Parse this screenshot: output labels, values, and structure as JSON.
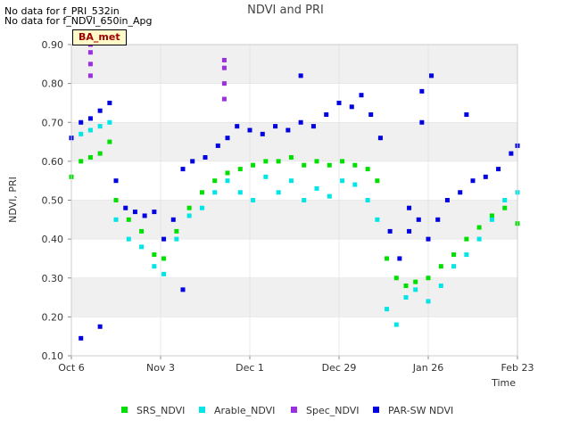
{
  "notes": [
    "No data for f_PRI_532in",
    "No data for f_NDVI_650in_Apg"
  ],
  "badge": "BA_met",
  "chart_data": {
    "type": "scatter",
    "title": "NDVI and PRI",
    "xlabel": "Time",
    "ylabel": "NDVI, PRI",
    "xlim": [
      "2023-10-06",
      "2024-02-23"
    ],
    "ylim": [
      0.1,
      0.9
    ],
    "yticks": [
      "0.10",
      "0.20",
      "0.30",
      "0.40",
      "0.50",
      "0.60",
      "0.70",
      "0.80",
      "0.90"
    ],
    "xticks": [
      {
        "date": "2023-10-06",
        "label": "Oct 6"
      },
      {
        "date": "2023-11-03",
        "label": "Nov 3"
      },
      {
        "date": "2023-12-01",
        "label": "Dec 1"
      },
      {
        "date": "2023-12-29",
        "label": "Dec 29"
      },
      {
        "date": "2024-01-26",
        "label": "Jan 26"
      },
      {
        "date": "2024-02-23",
        "label": "Feb 23"
      }
    ],
    "grid": true,
    "legend_position": "bottom",
    "series": [
      {
        "name": "SRS_NDVI",
        "color": "#00e000",
        "points": [
          [
            "2023-10-06",
            0.56
          ],
          [
            "2023-10-09",
            0.6
          ],
          [
            "2023-10-12",
            0.61
          ],
          [
            "2023-10-15",
            0.62
          ],
          [
            "2023-10-18",
            0.65
          ],
          [
            "2023-10-20",
            0.5
          ],
          [
            "2023-10-24",
            0.45
          ],
          [
            "2023-10-28",
            0.42
          ],
          [
            "2023-11-01",
            0.36
          ],
          [
            "2023-11-04",
            0.35
          ],
          [
            "2023-11-08",
            0.42
          ],
          [
            "2023-11-12",
            0.48
          ],
          [
            "2023-11-16",
            0.52
          ],
          [
            "2023-11-20",
            0.55
          ],
          [
            "2023-11-24",
            0.57
          ],
          [
            "2023-11-28",
            0.58
          ],
          [
            "2023-12-02",
            0.59
          ],
          [
            "2023-12-06",
            0.6
          ],
          [
            "2023-12-10",
            0.6
          ],
          [
            "2023-12-14",
            0.61
          ],
          [
            "2023-12-18",
            0.59
          ],
          [
            "2023-12-22",
            0.6
          ],
          [
            "2023-12-26",
            0.59
          ],
          [
            "2023-12-30",
            0.6
          ],
          [
            "2024-01-03",
            0.59
          ],
          [
            "2024-01-07",
            0.58
          ],
          [
            "2024-01-10",
            0.55
          ],
          [
            "2024-01-13",
            0.35
          ],
          [
            "2024-01-16",
            0.3
          ],
          [
            "2024-01-19",
            0.28
          ],
          [
            "2024-01-22",
            0.29
          ],
          [
            "2024-01-26",
            0.3
          ],
          [
            "2024-01-30",
            0.33
          ],
          [
            "2024-02-03",
            0.36
          ],
          [
            "2024-02-07",
            0.4
          ],
          [
            "2024-02-11",
            0.43
          ],
          [
            "2024-02-15",
            0.46
          ],
          [
            "2024-02-19",
            0.48
          ],
          [
            "2024-02-23",
            0.44
          ]
        ]
      },
      {
        "name": "Arable_NDVI",
        "color": "#00e5e5",
        "points": [
          [
            "2023-10-06",
            0.66
          ],
          [
            "2023-10-09",
            0.67
          ],
          [
            "2023-10-12",
            0.68
          ],
          [
            "2023-10-15",
            0.69
          ],
          [
            "2023-10-18",
            0.7
          ],
          [
            "2023-10-20",
            0.45
          ],
          [
            "2023-10-24",
            0.4
          ],
          [
            "2023-10-28",
            0.38
          ],
          [
            "2023-11-01",
            0.33
          ],
          [
            "2023-11-04",
            0.31
          ],
          [
            "2023-11-08",
            0.4
          ],
          [
            "2023-11-12",
            0.46
          ],
          [
            "2023-11-16",
            0.48
          ],
          [
            "2023-11-20",
            0.52
          ],
          [
            "2023-11-24",
            0.55
          ],
          [
            "2023-11-28",
            0.52
          ],
          [
            "2023-12-02",
            0.5
          ],
          [
            "2023-12-06",
            0.56
          ],
          [
            "2023-12-10",
            0.52
          ],
          [
            "2023-12-14",
            0.55
          ],
          [
            "2023-12-18",
            0.5
          ],
          [
            "2023-12-22",
            0.53
          ],
          [
            "2023-12-26",
            0.51
          ],
          [
            "2023-12-30",
            0.55
          ],
          [
            "2024-01-03",
            0.54
          ],
          [
            "2024-01-07",
            0.5
          ],
          [
            "2024-01-10",
            0.45
          ],
          [
            "2024-01-13",
            0.22
          ],
          [
            "2024-01-16",
            0.18
          ],
          [
            "2024-01-19",
            0.25
          ],
          [
            "2024-01-22",
            0.27
          ],
          [
            "2024-01-26",
            0.24
          ],
          [
            "2024-01-30",
            0.28
          ],
          [
            "2024-02-03",
            0.33
          ],
          [
            "2024-02-07",
            0.36
          ],
          [
            "2024-02-11",
            0.4
          ],
          [
            "2024-02-15",
            0.45
          ],
          [
            "2024-02-19",
            0.5
          ],
          [
            "2024-02-23",
            0.52
          ]
        ]
      },
      {
        "name": "Spec_NDVI",
        "color": "#9b30e0",
        "points": [
          [
            "2023-10-12",
            0.82
          ],
          [
            "2023-10-12",
            0.85
          ],
          [
            "2023-10-12",
            0.88
          ],
          [
            "2023-10-12",
            0.9
          ],
          [
            "2023-11-23",
            0.76
          ],
          [
            "2023-11-23",
            0.8
          ],
          [
            "2023-11-23",
            0.84
          ],
          [
            "2023-11-23",
            0.86
          ]
        ]
      },
      {
        "name": "PAR-SW NDVI",
        "color": "#0000e0",
        "points": [
          [
            "2023-10-06",
            0.66
          ],
          [
            "2023-10-09",
            0.7
          ],
          [
            "2023-10-12",
            0.71
          ],
          [
            "2023-10-15",
            0.73
          ],
          [
            "2023-10-18",
            0.75
          ],
          [
            "2023-10-20",
            0.55
          ],
          [
            "2023-10-23",
            0.48
          ],
          [
            "2023-10-26",
            0.47
          ],
          [
            "2023-10-29",
            0.46
          ],
          [
            "2023-11-01",
            0.47
          ],
          [
            "2023-11-04",
            0.4
          ],
          [
            "2023-11-07",
            0.45
          ],
          [
            "2023-11-10",
            0.58
          ],
          [
            "2023-11-13",
            0.6
          ],
          [
            "2023-11-17",
            0.61
          ],
          [
            "2023-11-21",
            0.64
          ],
          [
            "2023-11-24",
            0.66
          ],
          [
            "2023-11-27",
            0.69
          ],
          [
            "2023-12-01",
            0.68
          ],
          [
            "2023-12-05",
            0.67
          ],
          [
            "2023-12-09",
            0.69
          ],
          [
            "2023-12-13",
            0.68
          ],
          [
            "2023-12-17",
            0.7
          ],
          [
            "2023-12-21",
            0.69
          ],
          [
            "2023-12-25",
            0.72
          ],
          [
            "2023-12-29",
            0.75
          ],
          [
            "2024-01-02",
            0.74
          ],
          [
            "2024-01-05",
            0.77
          ],
          [
            "2024-01-08",
            0.72
          ],
          [
            "2024-01-11",
            0.66
          ],
          [
            "2024-01-14",
            0.42
          ],
          [
            "2024-01-17",
            0.35
          ],
          [
            "2024-01-20",
            0.42
          ],
          [
            "2024-01-23",
            0.45
          ],
          [
            "2024-01-26",
            0.4
          ],
          [
            "2024-01-29",
            0.45
          ],
          [
            "2024-02-01",
            0.5
          ],
          [
            "2024-02-05",
            0.52
          ],
          [
            "2024-02-09",
            0.55
          ],
          [
            "2024-02-13",
            0.56
          ],
          [
            "2024-02-17",
            0.58
          ],
          [
            "2024-02-21",
            0.62
          ],
          [
            "2024-02-23",
            0.64
          ],
          [
            "2023-10-09",
            0.145
          ],
          [
            "2023-10-15",
            0.175
          ],
          [
            "2023-11-10",
            0.27
          ],
          [
            "2023-12-17",
            0.82
          ],
          [
            "2024-01-27",
            0.82
          ],
          [
            "2024-01-24",
            0.78
          ],
          [
            "2024-01-24",
            0.7
          ],
          [
            "2024-02-07",
            0.72
          ],
          [
            "2024-01-20",
            0.48
          ]
        ]
      }
    ]
  }
}
